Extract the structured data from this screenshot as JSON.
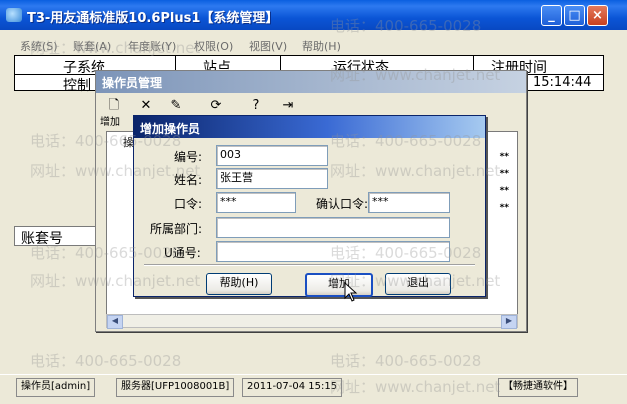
{
  "window": {
    "title": "T3-用友通标准版10.6Plus1【系统管理】",
    "minimize": "_",
    "maximize": "□",
    "close": "×"
  },
  "menu": [
    "系统(S)",
    "账套(A)",
    "年度账(Y)",
    "权限(O)",
    "视图(V)",
    "帮助(H)"
  ],
  "top_grid": {
    "headers": [
      "子系统",
      "站点",
      "运行状态",
      "注册时间"
    ],
    "row1": {
      "subsystem": "控制",
      "time": "15:14:44"
    }
  },
  "lower_grid": {
    "header": "账套号"
  },
  "operator_window": {
    "title": "操作员管理",
    "toolbar_add_label": "增加",
    "grid_header_fragment": "操",
    "password_masks": [
      "**",
      "**",
      "**",
      "**"
    ]
  },
  "dialog": {
    "title": "增加操作员",
    "labels": {
      "id": "编号:",
      "name": "姓名:",
      "password": "口令:",
      "confirm_password": "确认口令:",
      "department": "所属部门:",
      "pass_no": "U通号:"
    },
    "values": {
      "id": "003",
      "name": "张王营",
      "password": "***",
      "confirm_password": "***",
      "department": "",
      "pass_no": ""
    },
    "buttons": {
      "help": "帮助(H)",
      "add": "增加",
      "exit": "退出"
    }
  },
  "statusbar": {
    "operator": "操作员[admin]",
    "server": "服务器[UFP1008001B]",
    "datetime": "2011-07-04 15:15",
    "brand": "【畅捷通软件】"
  },
  "watermark": {
    "phone": "电话：400-665-0028",
    "site": "网址：www.chanjet.net"
  }
}
